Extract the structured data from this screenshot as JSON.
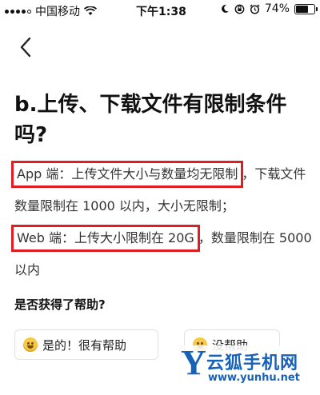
{
  "status_bar": {
    "carrier": "中国移动",
    "time": "下午1:38",
    "battery_percent": "74%",
    "battery_level": 0.74,
    "icons": [
      "signal-icon",
      "wifi-icon",
      "moon-icon",
      "orientation-lock-icon",
      "alarm-icon",
      "battery-icon"
    ]
  },
  "nav": {
    "back_icon": "chevron-left-icon"
  },
  "article": {
    "title": "b.上传、下载文件有限制条件吗?",
    "app_highlight": "App 端：上传文件大小与数量均无限制",
    "app_rest": "，下载文件数量限制在 1000 以内，大小无限制；",
    "web_highlight": "Web 端：上传大小限制在 20G",
    "web_rest": "，数量限制在 5000 以内",
    "highlight_color": "#e11d24"
  },
  "feedback": {
    "question": "是否获得了帮助?",
    "yes_label": "是的！很有帮助",
    "no_label": "没帮助"
  },
  "watermark": {
    "letter": "Y",
    "name": "云狐手机网",
    "url": "www.yunhu.net",
    "color": "#1662b8"
  }
}
